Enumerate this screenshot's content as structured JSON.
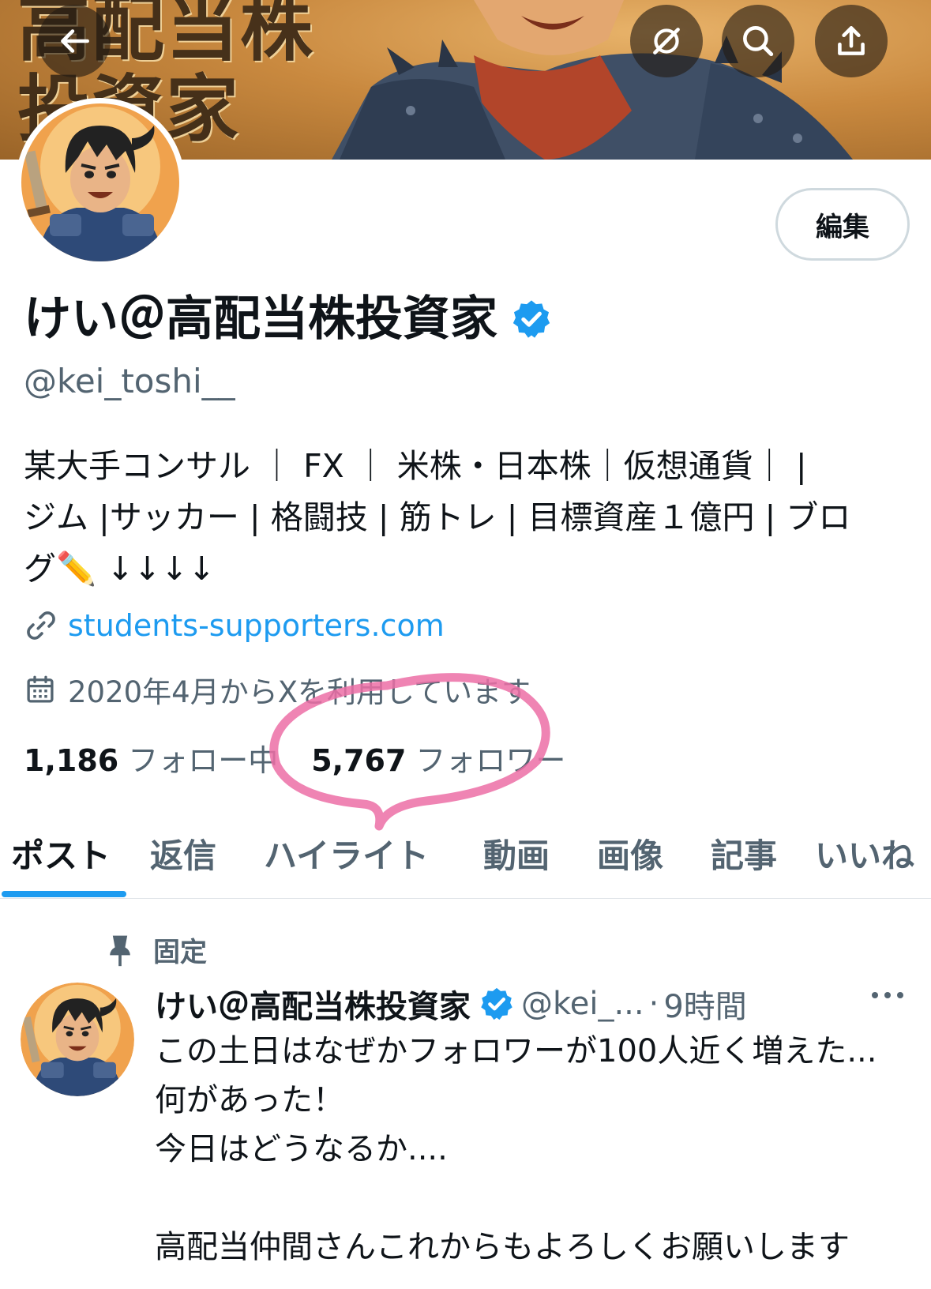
{
  "banner": {
    "title": "高配当株\n投資家"
  },
  "header_buttons": {
    "back": "back-arrow-icon",
    "grok": "grok-icon",
    "search": "search-icon",
    "share": "share-icon"
  },
  "profile": {
    "edit_label": "編集",
    "display_name": "けい＠高配当株投資家",
    "handle": "@kei_toshi__",
    "bio": "某大手コンサル ｜ FX ｜ 米株・日本株｜仮想通貨｜ |\nジム |サッカー | 格闘技 | 筋トレ | 目標資産１億円 | ブロ\nグ✏️ ↓↓↓↓",
    "link": "students-supporters.com",
    "joined": "2020年4月からXを利用しています",
    "following_count": "1,186",
    "following_label": "フォロー中",
    "followers_count": "5,767",
    "followers_label": "フォロワー"
  },
  "tabs": [
    {
      "label": "ポスト",
      "active": true
    },
    {
      "label": "返信",
      "active": false
    },
    {
      "label": "ハイライト",
      "active": false
    },
    {
      "label": "動画",
      "active": false
    },
    {
      "label": "画像",
      "active": false
    },
    {
      "label": "記事",
      "active": false
    },
    {
      "label": "いいね",
      "active": false
    }
  ],
  "pinned_post": {
    "pinned_label": "固定",
    "author": "けい＠高配当株投資家",
    "handle": "@kei_...",
    "separator": "·",
    "time": "9時間",
    "body": "この土日はなぜかフォロワーが100人近く増えた...\n何があった！\n今日はどうなるか....\n\n高配当仲間さんこれからもよろしくお願いします"
  },
  "colors": {
    "accent": "#1d9bf0",
    "text_primary": "#0f1419",
    "text_secondary": "#536471",
    "highlight_circle": "#ec6fa6"
  }
}
